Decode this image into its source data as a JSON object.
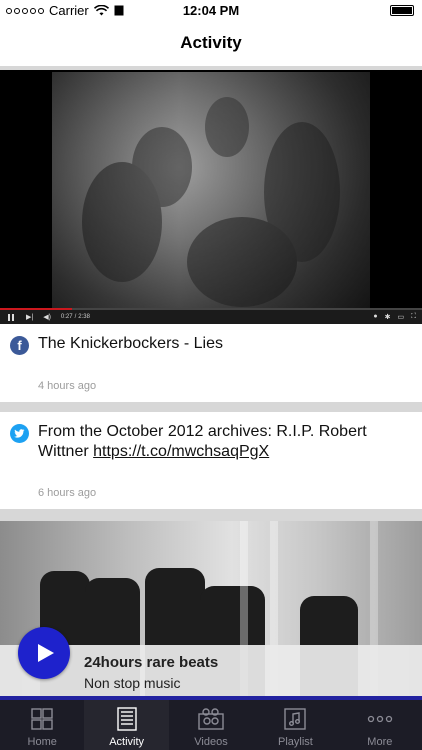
{
  "status_bar": {
    "carrier": "Carrier",
    "time": "12:04 PM"
  },
  "nav": {
    "title": "Activity"
  },
  "video": {
    "elapsed": "0:27",
    "duration": "2:38",
    "progress_fraction": 0.17
  },
  "feed": [
    {
      "source": "facebook",
      "icon": "facebook-icon",
      "text": "The Knickerbockers - Lies",
      "link": "",
      "time": "4 hours ago"
    },
    {
      "source": "twitter",
      "icon": "twitter-icon",
      "text": "From the October 2012 archives: R.I.P. Robert Wittner ",
      "link": "https://t.co/mwchsaqPgX",
      "time": "6 hours ago"
    }
  ],
  "player": {
    "title": "24hours rare beats",
    "subtitle": "Non stop music"
  },
  "tabs": [
    {
      "label": "Home",
      "icon": "home-grid-icon",
      "active": false
    },
    {
      "label": "Activity",
      "icon": "activity-list-icon",
      "active": true
    },
    {
      "label": "Videos",
      "icon": "videos-icon",
      "active": false
    },
    {
      "label": "Playlist",
      "icon": "playlist-music-icon",
      "active": false
    },
    {
      "label": "More",
      "icon": "more-dots-icon",
      "active": false
    }
  ],
  "colors": {
    "accent": "#1e22cc",
    "tabbar": "#1c1c26",
    "facebook": "#3b5998",
    "twitter": "#1da1f2"
  }
}
